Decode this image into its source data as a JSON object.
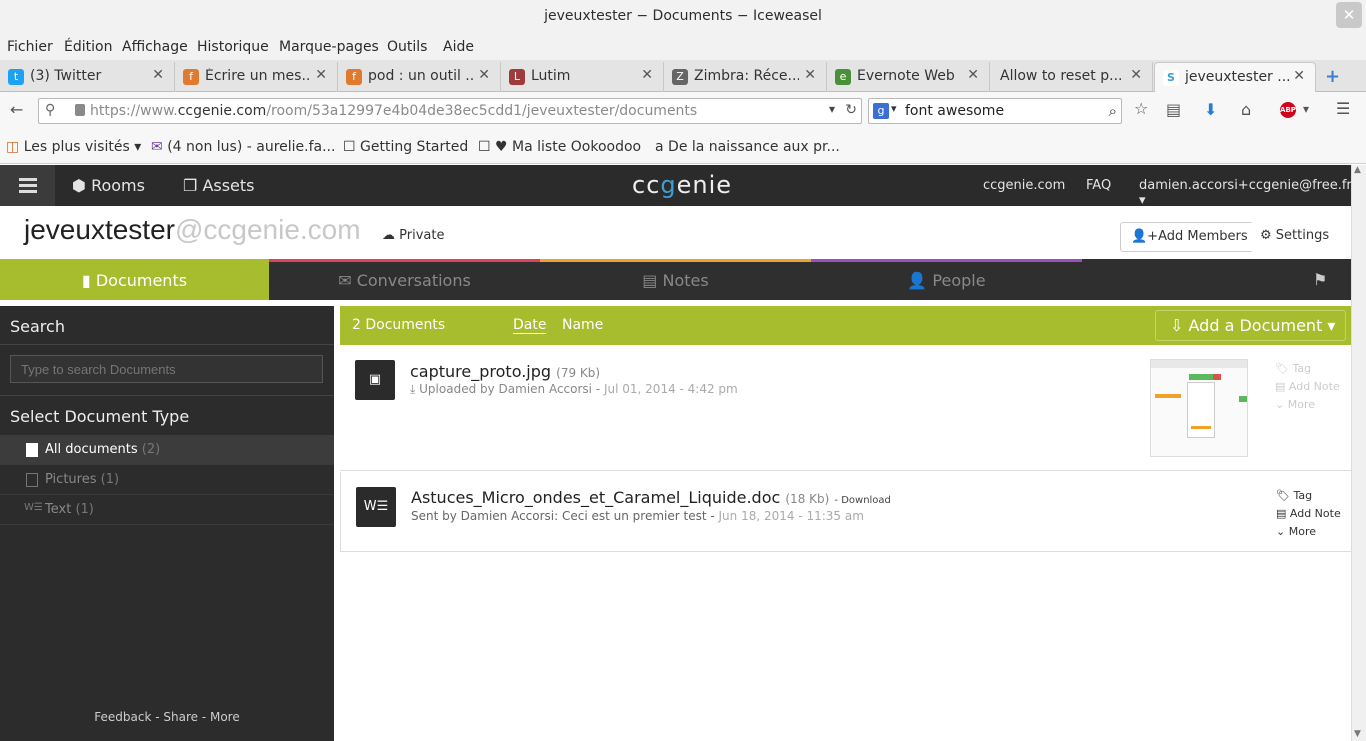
{
  "window": {
    "title": "jeveuxtester − Documents − Iceweasel"
  },
  "menu": [
    "Fichier",
    "Édition",
    "Affichage",
    "Historique",
    "Marque-pages",
    "Outils",
    "Aide"
  ],
  "tabs": [
    {
      "label": "(3) Twitter",
      "icon": "twitter-icon",
      "color": "#1da1f2"
    },
    {
      "label": "Écrire un mes...",
      "icon": "firefox-addon-icon",
      "color": "#e07a2f"
    },
    {
      "label": "pod : un outil ...",
      "icon": "firefox-addon-icon",
      "color": "#e07a2f"
    },
    {
      "label": "Lutim",
      "icon": "lutim-icon",
      "color": "#a03b3b"
    },
    {
      "label": "Zimbra: Réce...",
      "icon": "zimbra-icon",
      "color": "#666666"
    },
    {
      "label": "Evernote Web",
      "icon": "evernote-icon",
      "color": "#4a8f3a"
    },
    {
      "label": "Allow to reset p...",
      "icon": "",
      "color": ""
    },
    {
      "label": "jeveuxtester ...",
      "icon": "ccgenie-icon",
      "color": "#3b9fd6"
    }
  ],
  "navbar": {
    "url_prefix": "https://www.",
    "url_domain": "ccgenie.com",
    "url_path": "/room/53a12997e4b04de38ec5cdd1/jeveuxtester/documents",
    "search_query": "font awesome"
  },
  "bookmarks": [
    "Les plus visités",
    "(4 non lus) - aurelie.fa...",
    "Getting Started",
    "♥ Ma liste Ookoodoo",
    "De la naissance aux pr..."
  ],
  "app": {
    "nav_rooms": "Rooms",
    "nav_assets": "Assets",
    "logo_a": "cc",
    "logo_b": "g",
    "logo_c": "enie",
    "link_site": "ccgenie.com",
    "link_faq": "FAQ",
    "user_email": "damien.accorsi+ccgenie@free.fr"
  },
  "room": {
    "name": "jeveuxtester",
    "domain": "@ccgenie.com",
    "privacy": "Private",
    "add_members": "Add Members",
    "settings": "Settings"
  },
  "section_tabs": [
    {
      "label": "Documents",
      "color": "#a7bd2e"
    },
    {
      "label": "Conversations",
      "color": "#e0415f"
    },
    {
      "label": "Notes",
      "color": "#f0a12a"
    },
    {
      "label": "People",
      "color": "#9b4fc4"
    }
  ],
  "sidebar": {
    "search_heading": "Search",
    "search_placeholder": "Type to search Documents",
    "type_heading": "Select Document Type",
    "types": [
      {
        "label": "All documents",
        "count": "(2)"
      },
      {
        "label": "Pictures",
        "count": "(1)"
      },
      {
        "label": "Text",
        "count": "(1)"
      }
    ],
    "footer": "Feedback - Share - More"
  },
  "documents_header": {
    "count": "2 Documents",
    "sort_date": "Date",
    "sort_name": "Name",
    "add_document": "Add a Document"
  },
  "documents": [
    {
      "name": "capture_proto.jpg",
      "size": "(79 Kb)",
      "meta": "Uploaded by Damien Accorsi",
      "date": "Jul 01, 2014 - 4:42 pm",
      "actions": [
        "Tag",
        "Add Note",
        "More"
      ]
    },
    {
      "name": "Astuces_Micro_ondes_et_Caramel_Liquide.doc",
      "size": "(18 Kb)",
      "download": "- Download",
      "meta": "Sent by Damien Accorsi: Ceci est un premier test",
      "date": "Jun 18, 2014 - 11:35 am",
      "actions": [
        "Tag",
        "Add Note",
        "More"
      ]
    }
  ]
}
